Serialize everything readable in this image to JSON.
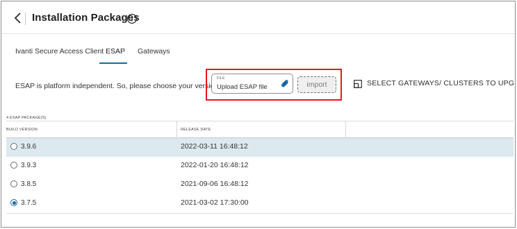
{
  "header": {
    "title": "Installation Packages",
    "back_icon": "chevron-left-icon",
    "info_icon": "info-circle-icon"
  },
  "tabs": [
    {
      "label": "Ivanti Secure Access Client",
      "active": false
    },
    {
      "label": "ESAP",
      "active": true
    },
    {
      "label": "Gateways",
      "active": false
    }
  ],
  "upload": {
    "prompt": "ESAP is platform independent. So, please choose your version.",
    "file_caption": "FILE",
    "file_placeholder": "Upload ESAP file",
    "attach_icon": "paperclip-icon",
    "import_label": "import",
    "gateways_link": "SELECT GATEWAYS/ CLUSTERS TO UPGRADE",
    "gateways_icon": "upgrade-window-icon"
  },
  "table": {
    "count_label": "4 ESAP PACKAGE(S)",
    "columns": [
      "BUILD VERSION",
      "RELEASE DATE",
      ""
    ],
    "rows": [
      {
        "version": "3.9.6",
        "release_date": "2022-03-11 16:48:12",
        "highlighted": true,
        "checked": false
      },
      {
        "version": "3.9.3",
        "release_date": "2022-01-20 16:48:12",
        "highlighted": false,
        "checked": false
      },
      {
        "version": "3.8.5",
        "release_date": "2021-09-06 16:48:12",
        "highlighted": false,
        "checked": false
      },
      {
        "version": "3.7.5",
        "release_date": "2021-03-02 17:30:00",
        "highlighted": false,
        "checked": true
      }
    ]
  },
  "colors": {
    "accent": "#0b6fa4",
    "selected_row": "#dce9ef",
    "highlight_border": "#e2191f"
  }
}
